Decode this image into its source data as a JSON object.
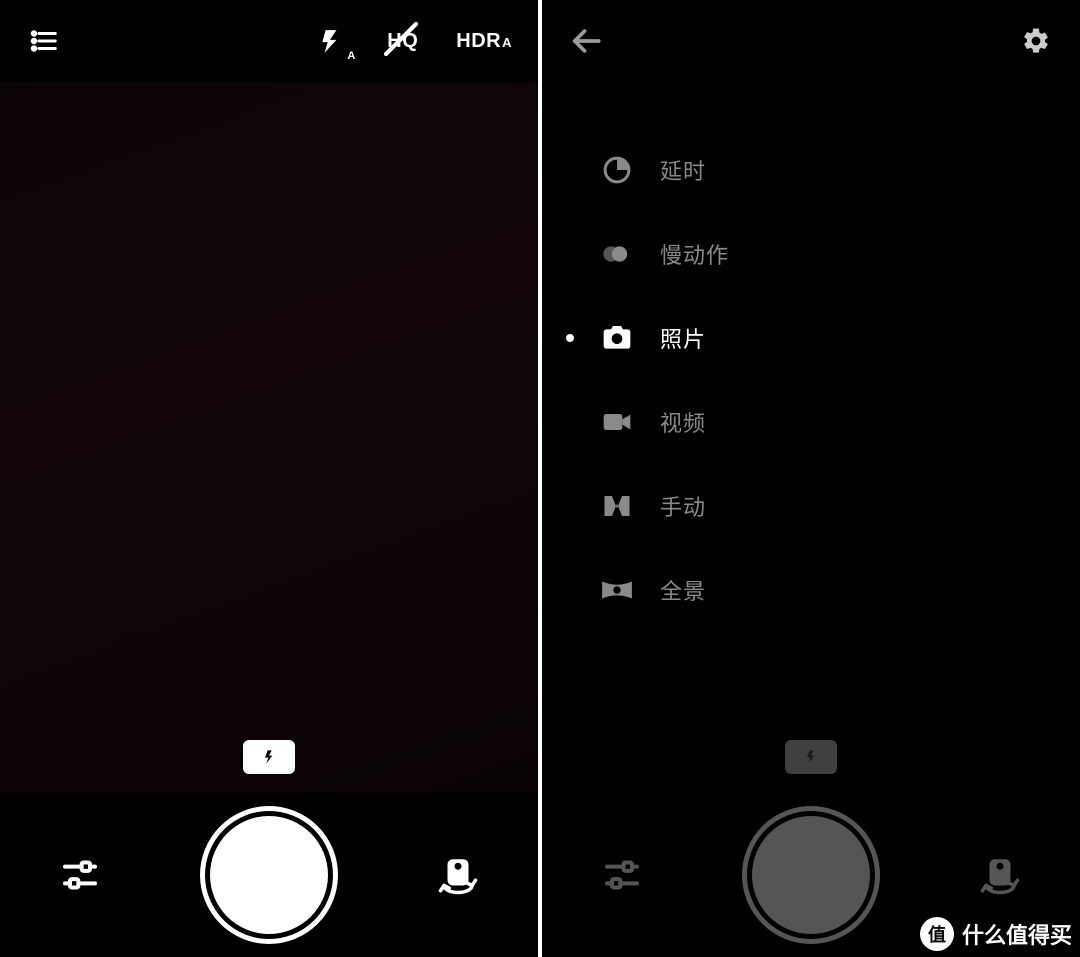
{
  "left": {
    "top": {
      "flash_sub": "A",
      "hq_label": "HQ",
      "hdr_label": "HDR",
      "hdr_sub": "A"
    }
  },
  "right": {
    "modes": [
      {
        "id": "timelapse",
        "label": "延时",
        "selected": false
      },
      {
        "id": "slowmo",
        "label": "慢动作",
        "selected": false
      },
      {
        "id": "photo",
        "label": "照片",
        "selected": true
      },
      {
        "id": "video",
        "label": "视频",
        "selected": false
      },
      {
        "id": "manual",
        "label": "手动",
        "selected": false
      },
      {
        "id": "panorama",
        "label": "全景",
        "selected": false
      }
    ]
  },
  "watermark": {
    "badge": "值",
    "text": "什么值得买"
  }
}
